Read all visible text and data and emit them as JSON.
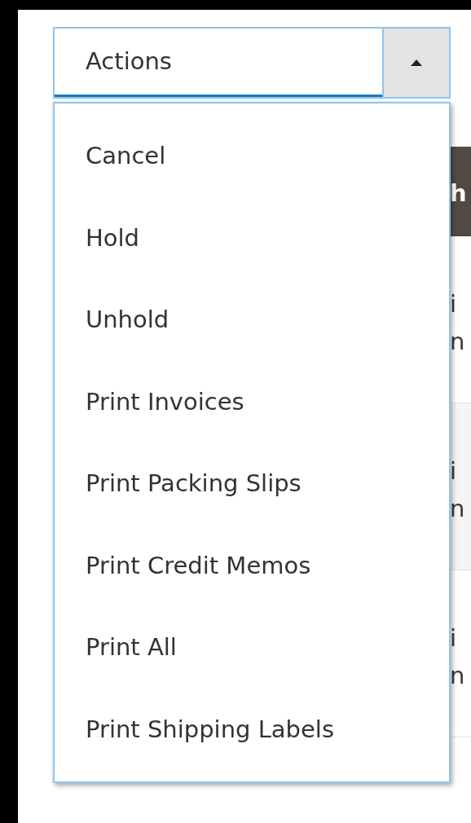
{
  "actions_select": {
    "label": "Actions",
    "expanded": true
  },
  "menu_items": [
    {
      "label": "Cancel"
    },
    {
      "label": "Hold"
    },
    {
      "label": "Unhold"
    },
    {
      "label": "Print Invoices"
    },
    {
      "label": "Print Packing Slips"
    },
    {
      "label": "Print Credit Memos"
    },
    {
      "label": "Print All"
    },
    {
      "label": "Print Shipping Labels"
    }
  ],
  "table": {
    "header": "h",
    "rows": [
      {
        "lines": [
          "i",
          "n"
        ]
      },
      {
        "lines": [
          "i",
          "n"
        ]
      },
      {
        "lines": [
          "i",
          "n"
        ]
      }
    ]
  }
}
